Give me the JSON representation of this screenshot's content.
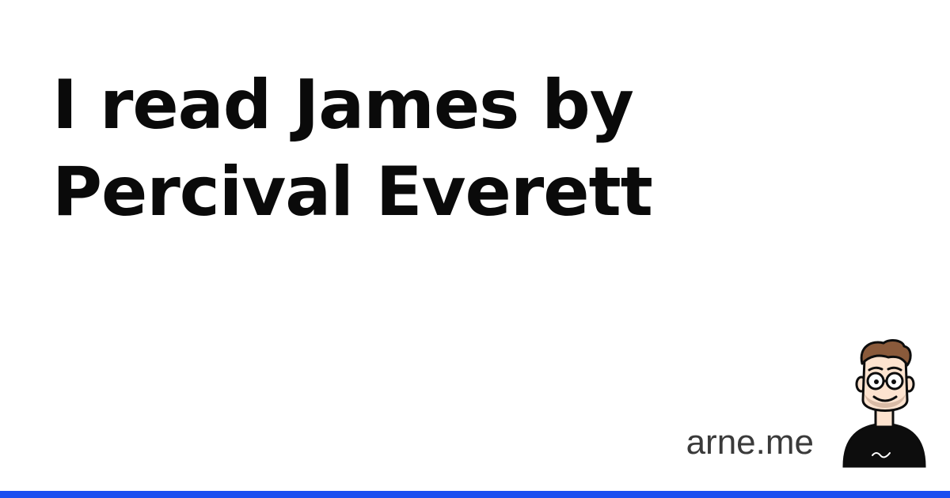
{
  "post": {
    "title_line1": "I read James by",
    "title_line2": "Percival Everett"
  },
  "site": {
    "name": "arne.me"
  },
  "avatar": {
    "icon": "cartoon-avatar-illustration"
  },
  "colors": {
    "accent": "#1a4ff0",
    "title": "#0a0a0a",
    "site_text": "#3a3a3a"
  }
}
